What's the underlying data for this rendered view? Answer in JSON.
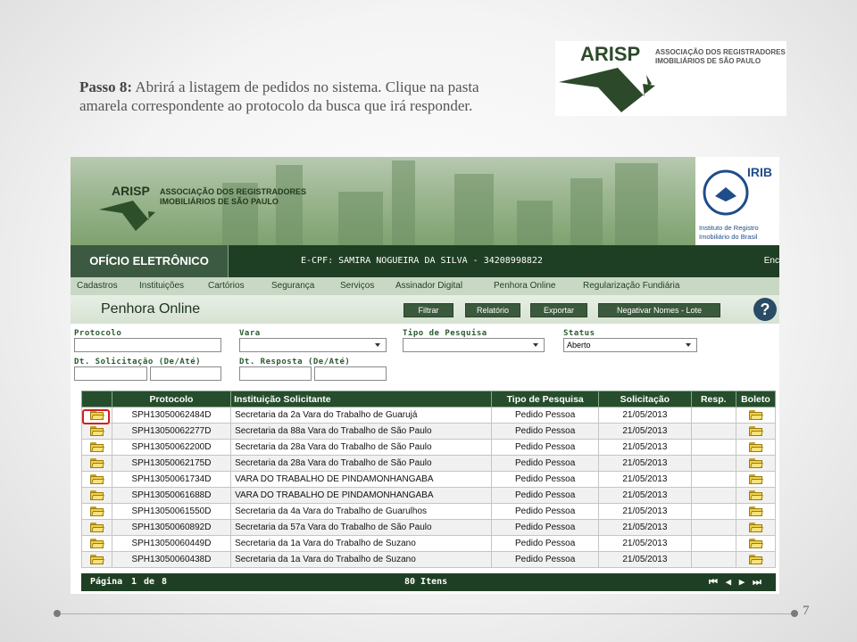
{
  "slide": {
    "step_label": "Passo 8:",
    "step_text": "Abrirá a listagem de pedidos no sistema. Clique na pasta amarela correspondente ao protocolo da busca que irá responder.",
    "page_number": "7"
  },
  "logo_top": {
    "wordmark": "ARISP",
    "line1": "ASSOCIAÇÃO DOS REGISTRADORES",
    "line2": "IMOBILIÁRIOS DE SÃO PAULO"
  },
  "app": {
    "banner": {
      "wordmark": "ARISP",
      "line1": "ASSOCIAÇÃO DOS REGISTRADORES",
      "line2": "IMOBILIÁRIOS DE SÃO PAULO",
      "irib_title": "IRIB",
      "irib_line1": "Instituto de Registro",
      "irib_line2": "Imobiliário do Brasil"
    },
    "title": "OFÍCIO ELETRÔNICO",
    "user": "E-CPF: SAMIRA NOGUEIRA DA SILVA - 34208998822",
    "end_text": "Enc",
    "menu": [
      "Cadastros",
      "Instituições",
      "Cartórios",
      "Segurança",
      "Serviços",
      "Assinador Digital",
      "Penhora Online",
      "Regularização Fundiária"
    ],
    "page_title": "Penhora Online",
    "buttons": {
      "filtrar": "Filtrar",
      "relatorio": "Relatório",
      "exportar": "Exportar",
      "negativar": "Negativar Nomes - Lote"
    },
    "help": "?",
    "filters": {
      "protocolo": "Protocolo",
      "vara": "Vara",
      "tipo_pesquisa": "Tipo de Pesquisa",
      "status": "Status",
      "status_value": "Aberto",
      "dt_solicitacao": "Dt. Solicitação (De/Até)",
      "dt_resposta": "Dt. Resposta (De/Até)"
    },
    "table": {
      "headers": [
        "",
        "Protocolo",
        "Instituição Solicitante",
        "Tipo de Pesquisa",
        "Solicitação",
        "Resp.",
        "Boleto"
      ],
      "rows": [
        {
          "protocolo": "SPH13050062484D",
          "instituicao": "Secretaria da 2a Vara do Trabalho de Guarujá",
          "tipo": "Pedido Pessoa",
          "solicitacao": "21/05/2013",
          "resp": ""
        },
        {
          "protocolo": "SPH13050062277D",
          "instituicao": "Secretaria da 88a Vara do Trabalho de São Paulo",
          "tipo": "Pedido Pessoa",
          "solicitacao": "21/05/2013",
          "resp": ""
        },
        {
          "protocolo": "SPH13050062200D",
          "instituicao": "Secretaria da 28a Vara do Trabalho de São Paulo",
          "tipo": "Pedido Pessoa",
          "solicitacao": "21/05/2013",
          "resp": ""
        },
        {
          "protocolo": "SPH13050062175D",
          "instituicao": "Secretaria da 28a Vara do Trabalho de São Paulo",
          "tipo": "Pedido Pessoa",
          "solicitacao": "21/05/2013",
          "resp": ""
        },
        {
          "protocolo": "SPH13050061734D",
          "instituicao": "VARA DO TRABALHO DE PINDAMONHANGABA",
          "tipo": "Pedido Pessoa",
          "solicitacao": "21/05/2013",
          "resp": ""
        },
        {
          "protocolo": "SPH13050061688D",
          "instituicao": "VARA DO TRABALHO DE PINDAMONHANGABA",
          "tipo": "Pedido Pessoa",
          "solicitacao": "21/05/2013",
          "resp": ""
        },
        {
          "protocolo": "SPH13050061550D",
          "instituicao": "Secretaria da 4a Vara do Trabalho de Guarulhos",
          "tipo": "Pedido Pessoa",
          "solicitacao": "21/05/2013",
          "resp": ""
        },
        {
          "protocolo": "SPH13050060892D",
          "instituicao": "Secretaria da 57a Vara do Trabalho de São Paulo",
          "tipo": "Pedido Pessoa",
          "solicitacao": "21/05/2013",
          "resp": ""
        },
        {
          "protocolo": "SPH13050060449D",
          "instituicao": "Secretaria da 1a Vara do Trabalho de Suzano",
          "tipo": "Pedido Pessoa",
          "solicitacao": "21/05/2013",
          "resp": ""
        },
        {
          "protocolo": "SPH13050060438D",
          "instituicao": "Secretaria da 1a Vara do Trabalho de Suzano",
          "tipo": "Pedido Pessoa",
          "solicitacao": "21/05/2013",
          "resp": ""
        }
      ]
    },
    "footer": {
      "page_label": "Página",
      "page_current": "1",
      "page_of": "de",
      "page_total": "8",
      "items": "80 Itens"
    }
  }
}
